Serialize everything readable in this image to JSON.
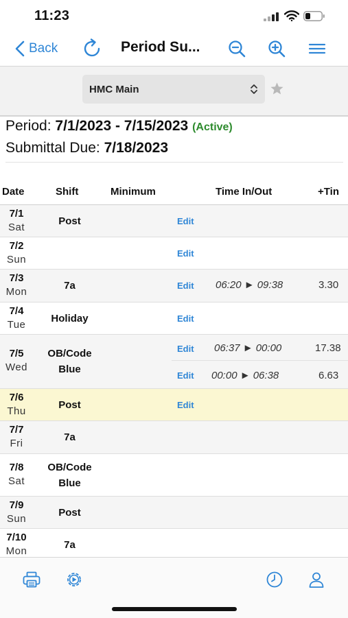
{
  "status_bar": {
    "time": "11:23"
  },
  "nav": {
    "back_label": "Back",
    "title": "Period Su..."
  },
  "selector": {
    "location": "HMC Main"
  },
  "period": {
    "period_label": "Period:",
    "period_range": "7/1/2023 - 7/15/2023",
    "status": "(Active)",
    "due_label": "Submittal Due:",
    "due_date": "7/18/2023"
  },
  "table": {
    "headers": {
      "date": "Date",
      "shift": "Shift",
      "minimum": "Minimum",
      "time": "Time In/Out",
      "hours": "+Tin"
    },
    "edit_label": "Edit",
    "rows": [
      {
        "date": "7/1",
        "dow": "Sat",
        "shift": "Post"
      },
      {
        "date": "7/2",
        "dow": "Sun",
        "shift": ""
      },
      {
        "date": "7/3",
        "dow": "Mon",
        "shift": "7a",
        "time": "06:20 ► 09:38",
        "hours": "3.30"
      },
      {
        "date": "7/4",
        "dow": "Tue",
        "shift": "Holiday"
      },
      {
        "date": "7/5",
        "dow": "Wed",
        "shift_line1": "OB/Code",
        "shift_line2": "Blue",
        "entries": [
          {
            "time": "06:37 ► 00:00",
            "hours": "17.38"
          },
          {
            "time": "00:00 ► 06:38",
            "hours": "6.63"
          }
        ]
      },
      {
        "date": "7/6",
        "dow": "Thu",
        "shift": "Post"
      },
      {
        "date": "7/7",
        "dow": "Fri",
        "shift": "7a"
      },
      {
        "date": "7/8",
        "dow": "Sat",
        "shift_line1": "OB/Code",
        "shift_line2": "Blue"
      },
      {
        "date": "7/9",
        "dow": "Sun",
        "shift": "Post"
      },
      {
        "date": "7/10",
        "dow": "Mon",
        "shift": "7a"
      }
    ]
  },
  "bottom_bar": {
    "icons": [
      "print-icon",
      "settings-icon",
      "clock-icon",
      "profile-icon"
    ]
  },
  "colors": {
    "accent": "#2f86d6",
    "active_status": "#2e8b2e",
    "highlight_row": "#fbf7d2"
  }
}
